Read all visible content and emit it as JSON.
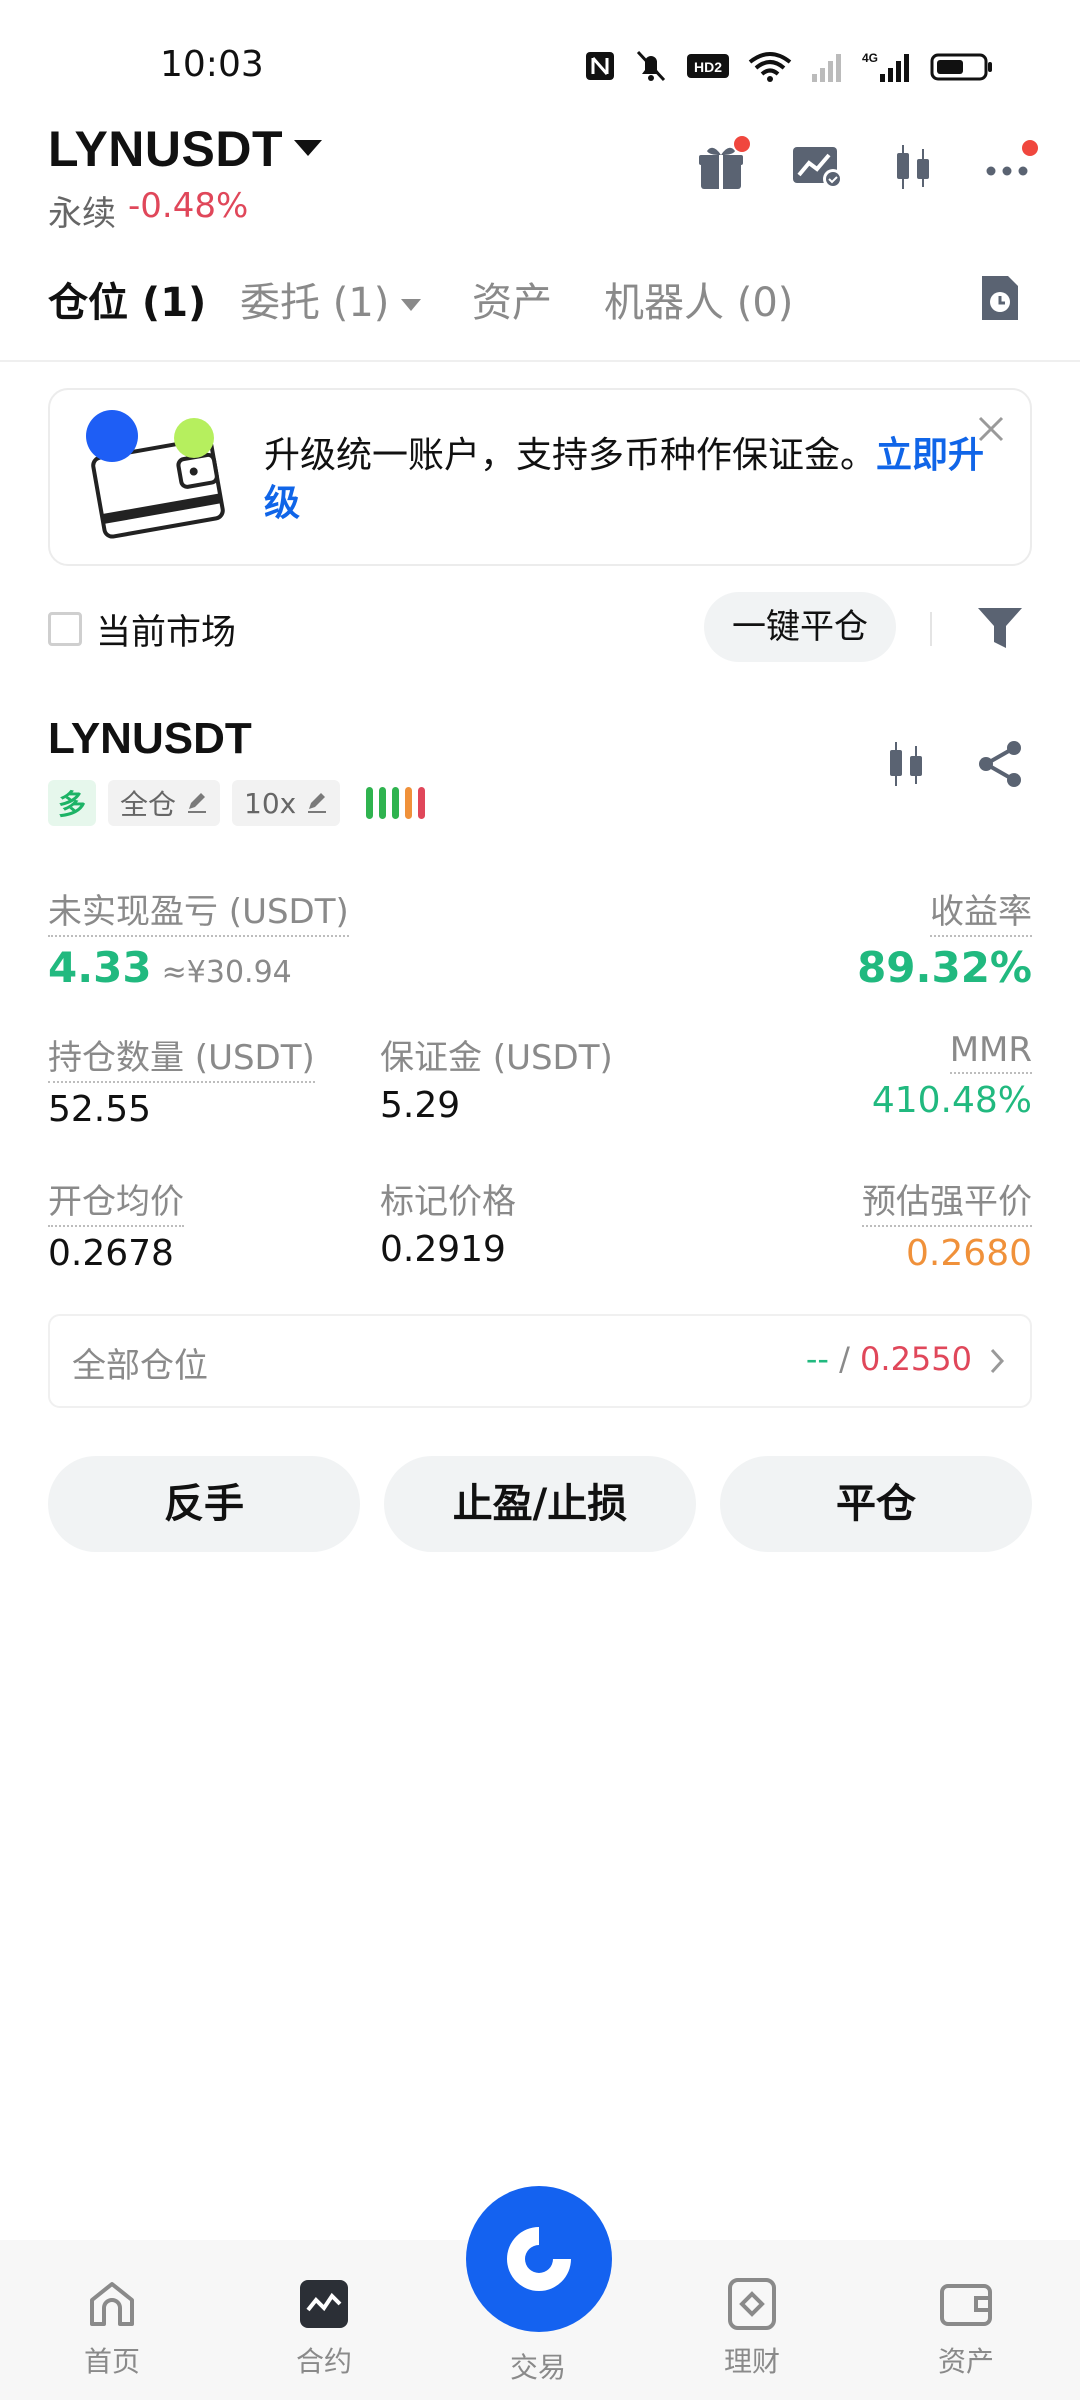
{
  "status_bar": {
    "time": "10:03",
    "hd_label": "HD2",
    "network_label": "4G"
  },
  "header": {
    "symbol": "LYNUSDT",
    "type": "永续",
    "change": "-0.48%",
    "icons": [
      "gift-icon",
      "chart-alert-icon",
      "candlestick-icon",
      "more-icon"
    ]
  },
  "tabs": [
    {
      "label": "仓位 (1)",
      "active": true
    },
    {
      "label": "委托 (1)",
      "active": false
    },
    {
      "label": "资产",
      "active": false
    },
    {
      "label": "机器人 (0)",
      "active": false
    }
  ],
  "banner": {
    "text": "升级统一账户，支持多币种作保证金。",
    "link": "立即升级"
  },
  "filter": {
    "current_market_label": "当前市场",
    "close_all_label": "一键平仓"
  },
  "position": {
    "symbol": "LYNUSDT",
    "side": "多",
    "margin_mode": "全仓",
    "leverage": "10x",
    "risk_level_colors": [
      "#2fb34f",
      "#2fb34f",
      "#2fb34f",
      "#f0913a",
      "#e0475a"
    ],
    "unrealized_pnl_label": "未实现盈亏 (USDT)",
    "unrealized_pnl": "4.33",
    "unrealized_pnl_cny": "≈¥30.94",
    "roe_label": "收益率",
    "roe": "89.32%",
    "size_label": "持仓数量 (USDT)",
    "size": "52.55",
    "margin_label": "保证金 (USDT)",
    "margin": "5.29",
    "mmr_label": "MMR",
    "mmr": "410.48%",
    "entry_label": "开仓均价",
    "entry": "0.2678",
    "mark_label": "标记价格",
    "mark": "0.2919",
    "liq_label": "预估强平价",
    "liq": "0.2680",
    "all_positions_label": "全部仓位",
    "all_positions_tp": "--",
    "all_positions_sep": "/",
    "all_positions_sl": "0.2550"
  },
  "actions": {
    "reverse": "反手",
    "tpsl": "止盈/止损",
    "close": "平仓"
  },
  "bottom_nav": [
    {
      "label": "首页",
      "icon": "home-icon"
    },
    {
      "label": "合约",
      "icon": "contract-icon"
    },
    {
      "label": "交易",
      "icon": "trade-icon"
    },
    {
      "label": "理财",
      "icon": "finance-icon"
    },
    {
      "label": "资产",
      "icon": "wallet-icon"
    }
  ],
  "colors": {
    "green": "#21b97f",
    "red": "#e0475a",
    "orange": "#f0913a",
    "blue": "#1462f0"
  }
}
